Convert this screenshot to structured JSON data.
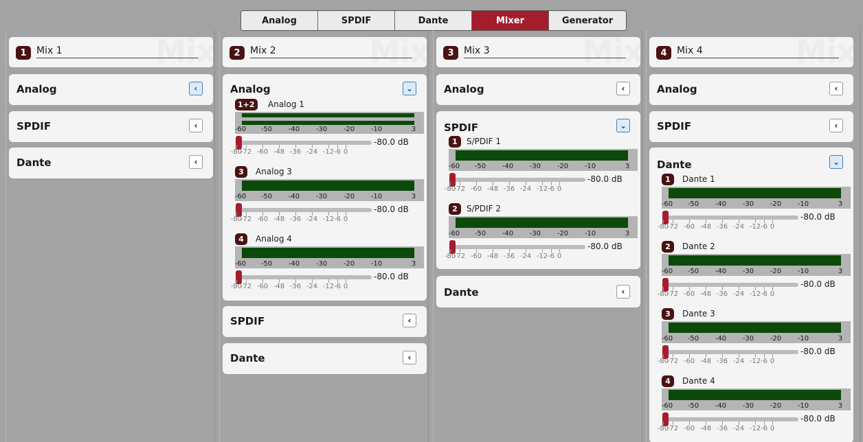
{
  "tabs": [
    "Analog",
    "SPDIF",
    "Dante",
    "Mixer",
    "Generator"
  ],
  "active_tab": "Mixer",
  "mixes": [
    {
      "num": "1",
      "name": "Mix 1",
      "watermark": "Mix"
    },
    {
      "num": "2",
      "name": "Mix 2",
      "watermark": "Mix"
    },
    {
      "num": "3",
      "name": "Mix 3",
      "watermark": "Mix"
    },
    {
      "num": "4",
      "name": "Mix 4",
      "watermark": "Mix"
    }
  ],
  "sections": {
    "analog": "Analog",
    "spdif": "SPDIF",
    "dante": "Dante"
  },
  "channels": {
    "analog1": {
      "badge": "1+2",
      "name": "Analog 1",
      "db": "-80.0 dB"
    },
    "analog3": {
      "badge": "3",
      "name": "Analog 3",
      "db": "-80.0 dB"
    },
    "analog4": {
      "badge": "4",
      "name": "Analog 4",
      "db": "-80.0 dB"
    },
    "spdif1": {
      "badge": "1",
      "name": "S/PDIF 1",
      "db": "-80.0 dB"
    },
    "spdif2": {
      "badge": "2",
      "name": "S/PDIF 2",
      "db": "-80.0 dB"
    },
    "dante1": {
      "badge": "1",
      "name": "Dante 1",
      "db": "-80.0 dB"
    },
    "dante2": {
      "badge": "2",
      "name": "Dante 2",
      "db": "-80.0 dB"
    },
    "dante3": {
      "badge": "3",
      "name": "Dante 3",
      "db": "-80.0 dB"
    },
    "dante4": {
      "badge": "4",
      "name": "Dante 4",
      "db": "-80.0 dB"
    }
  },
  "meter_scale": [
    "-60",
    "-50",
    "-40",
    "-30",
    "-20",
    "-10",
    "3"
  ],
  "fader_scale": [
    "-80",
    "-72",
    "-60",
    "-48",
    "-36",
    "-24",
    "-12",
    "-6",
    "0"
  ],
  "icons": {
    "collapsed": "chevron-left-icon",
    "expanded": "chevron-down-icon"
  },
  "colors": {
    "accent": "#a51c2d",
    "meter": "#0b4a0b",
    "badge": "#4a1212"
  }
}
